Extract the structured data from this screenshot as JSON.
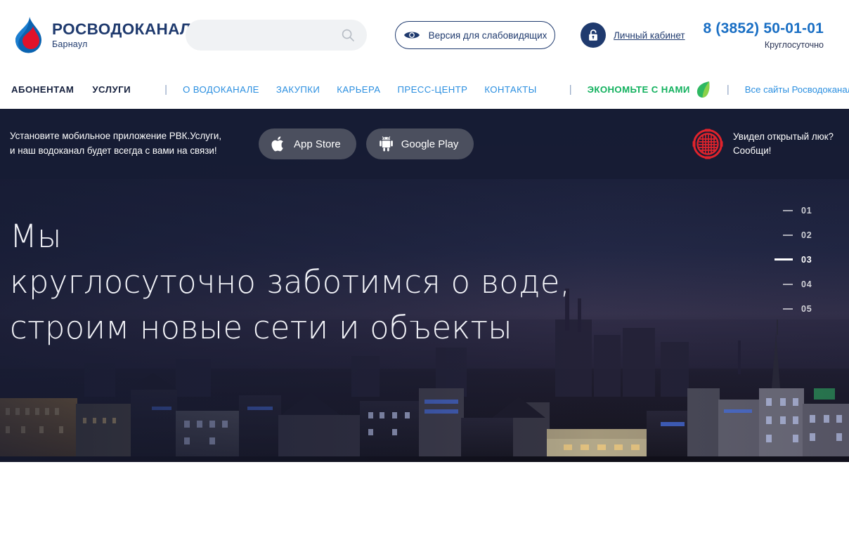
{
  "brand": {
    "logo_icon": "water-drop-logo-icon",
    "title": "РОСВОДОКАНАЛ",
    "city": "Барнаул",
    "colors": {
      "blue": "#1a6fc4",
      "navy": "#1f3a6e",
      "red": "#e0122a",
      "green": "#12b15e",
      "link_blue": "#2b8fe0"
    }
  },
  "search": {
    "value": "",
    "placeholder": "",
    "icon": "search-icon"
  },
  "accessibility": {
    "label": "Версия для слабовидящих",
    "icon": "eye-icon"
  },
  "cabinet": {
    "label": "Личный кабинет",
    "icon": "lock-icon"
  },
  "phone": {
    "number": "8 (3852) 50-01-01",
    "note": "Круглосуточно"
  },
  "nav": {
    "primary": [
      {
        "label": "АБОНЕНТАМ"
      },
      {
        "label": "УСЛУГИ"
      }
    ],
    "separator": "|",
    "links": [
      {
        "label": "О ВОДОКАНАЛЕ"
      },
      {
        "label": "ЗАКУПКИ"
      },
      {
        "label": "КАРЬЕРА"
      },
      {
        "label": "ПРЕСС-ЦЕНТР"
      },
      {
        "label": "КОНТАКТЫ"
      }
    ],
    "eco": {
      "label": "ЭКОНОМЬТЕ С НАМИ",
      "icon": "leaf-icon"
    },
    "all_sites": {
      "label": "Все сайты Росводоканал",
      "icon": "plus-circle-icon"
    }
  },
  "promo": {
    "text_line1": "Установите мобильное приложение РВК.Услуги,",
    "text_line2": "и наш водоканал будет всегда с вами на связи!",
    "buttons": [
      {
        "label": "App Store",
        "icon": "apple-icon"
      },
      {
        "label": "Google Play",
        "icon": "android-icon"
      }
    ],
    "hatch": {
      "icon": "manhole-cover-icon",
      "line1": "Увидел открытый люк?",
      "line2": "Сообщи!"
    }
  },
  "hero": {
    "line1": "Мы",
    "line2": "круглосуточно заботимся о воде,",
    "line3": "строим новые сети и объекты",
    "slides": [
      {
        "num": "01",
        "active": false
      },
      {
        "num": "02",
        "active": false
      },
      {
        "num": "03",
        "active": true
      },
      {
        "num": "04",
        "active": false
      },
      {
        "num": "05",
        "active": false
      }
    ]
  }
}
